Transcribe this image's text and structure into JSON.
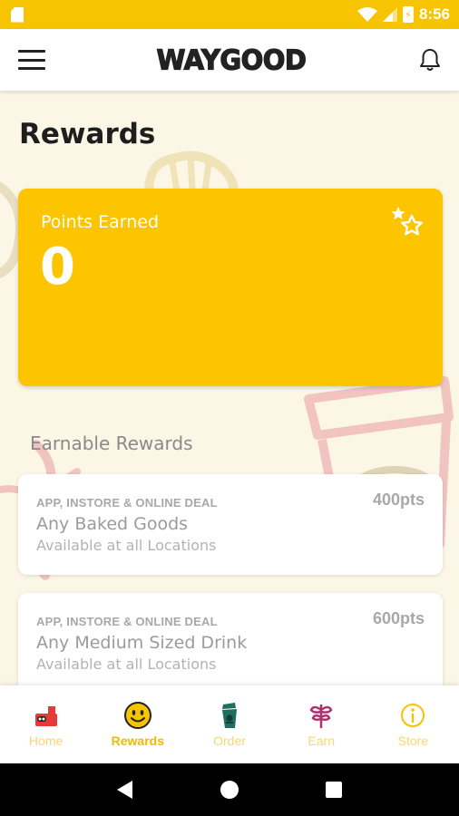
{
  "status_bar": {
    "time": "8:56",
    "battery_glyph": "⚡"
  },
  "header": {
    "brand": "WAYGOOD",
    "menu_icon": "hamburger-menu-icon",
    "bell_icon": "bell-icon"
  },
  "page": {
    "title": "Rewards"
  },
  "points_card": {
    "label": "Points Earned",
    "value": "0",
    "icon": "stars-icon",
    "background_color": "#fcc500"
  },
  "earnable": {
    "title": "Earnable Rewards",
    "rewards": [
      {
        "tag": "APP, INSTORE & ONLINE DEAL",
        "name": "Any Baked Goods",
        "availability": "Available at all Locations",
        "points": "400pts"
      },
      {
        "tag": "APP, INSTORE & ONLINE DEAL",
        "name": "Any Medium Sized Drink",
        "availability": "Available at all Locations",
        "points": "600pts"
      }
    ]
  },
  "bottom_nav": {
    "active": "Rewards",
    "items": [
      {
        "label": "Home",
        "icon": "home-icon"
      },
      {
        "label": "Rewards",
        "icon": "smiley-icon"
      },
      {
        "label": "Order",
        "icon": "cup-icon"
      },
      {
        "label": "Earn",
        "icon": "plant-icon"
      },
      {
        "label": "Store",
        "icon": "info-icon"
      }
    ]
  },
  "colors": {
    "accent": "#f6c400",
    "background": "#fbf6e6"
  }
}
